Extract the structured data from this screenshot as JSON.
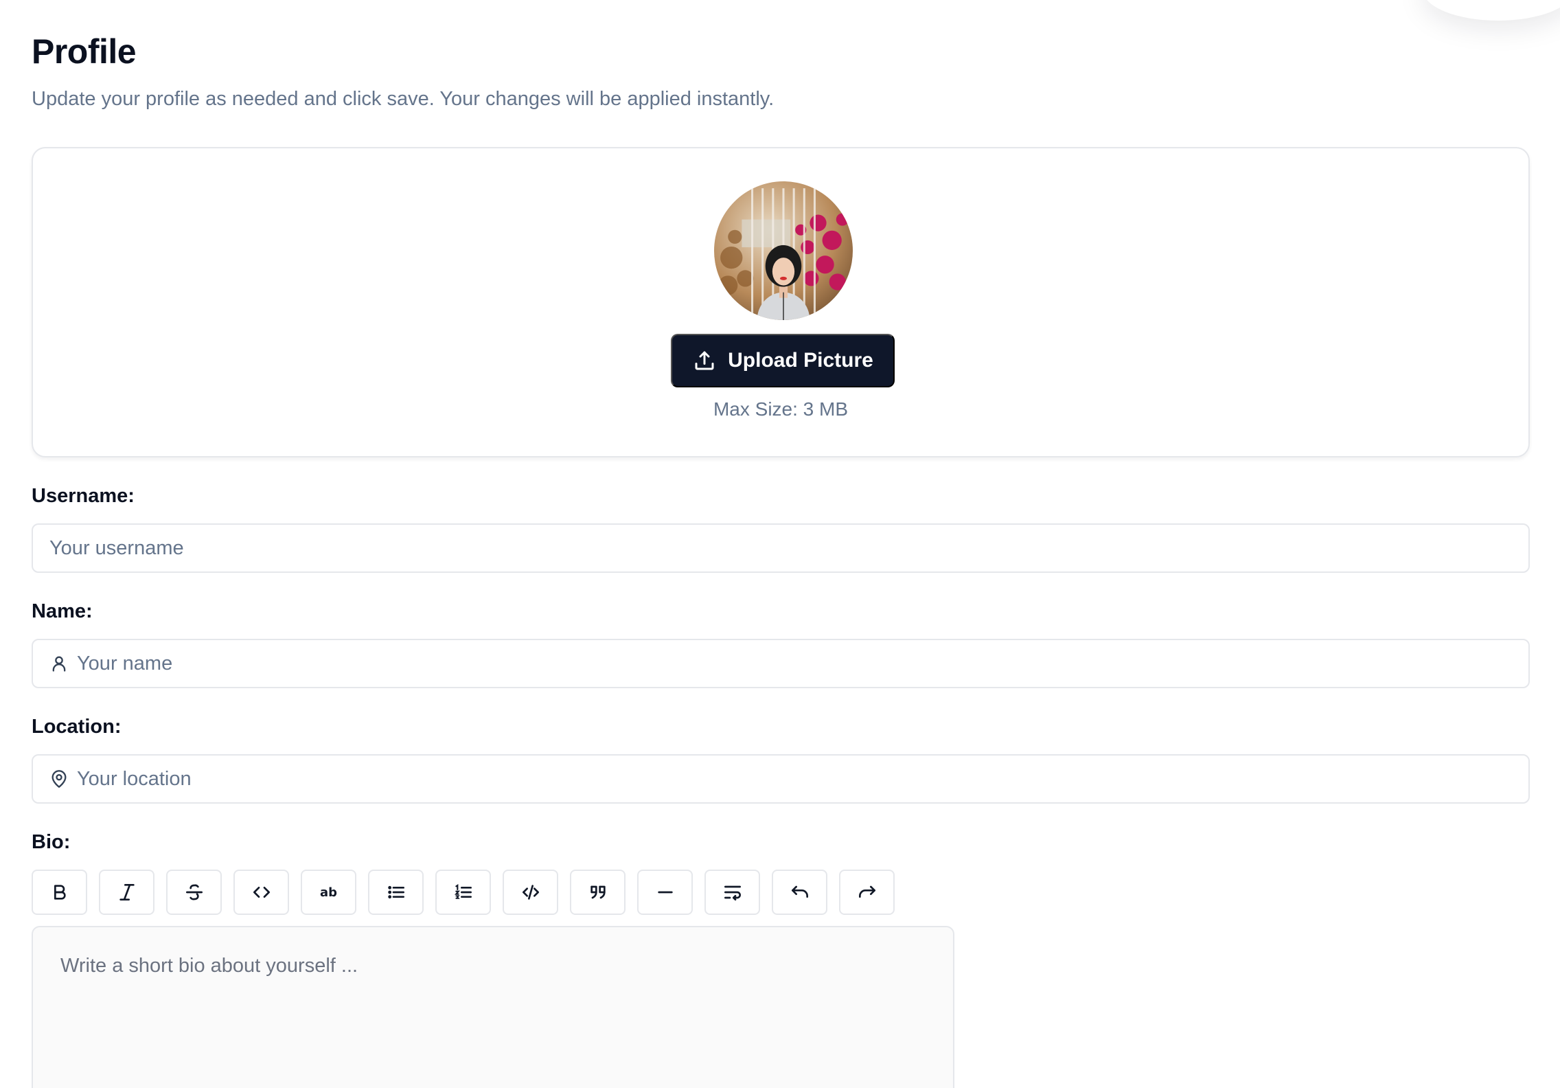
{
  "page": {
    "title": "Profile",
    "subtitle": "Update your profile as needed and click save. Your changes will be applied instantly."
  },
  "avatar_card": {
    "upload_label": "Upload Picture",
    "upload_icon": "upload-icon",
    "max_size": "Max Size: 3 MB"
  },
  "fields": {
    "username": {
      "label": "Username:",
      "placeholder": "Your username",
      "value": ""
    },
    "name": {
      "label": "Name:",
      "placeholder": "Your name",
      "value": "",
      "icon": "user-icon"
    },
    "location": {
      "label": "Location:",
      "placeholder": "Your location",
      "value": "",
      "icon": "map-pin-icon"
    }
  },
  "bio": {
    "label": "Bio:",
    "placeholder": "Write a short bio about yourself ...",
    "value": "",
    "toolbar": [
      {
        "name": "bold-icon"
      },
      {
        "name": "italic-icon"
      },
      {
        "name": "strikethrough-icon"
      },
      {
        "name": "code-icon"
      },
      {
        "name": "clear-format-icon",
        "text": "ab"
      },
      {
        "name": "bullet-list-icon"
      },
      {
        "name": "ordered-list-icon"
      },
      {
        "name": "code-block-icon"
      },
      {
        "name": "blockquote-icon"
      },
      {
        "name": "horizontal-rule-icon"
      },
      {
        "name": "hard-break-icon"
      },
      {
        "name": "undo-icon"
      },
      {
        "name": "redo-icon"
      }
    ]
  },
  "colors": {
    "primary": "#0f172a",
    "muted_text": "#64748b",
    "border": "#e5e7eb"
  }
}
